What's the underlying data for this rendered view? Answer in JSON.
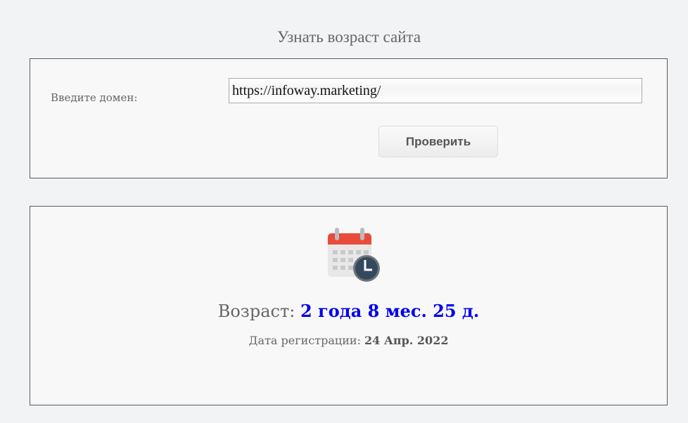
{
  "header": {
    "title": "Узнать возраст сайта"
  },
  "form": {
    "domain_label": "Введите домен:",
    "domain_value": "https://infoway.marketing/",
    "submit_label": "Проверить"
  },
  "result": {
    "age_label": "Возраст:",
    "age_value": "2 года 8 мес. 25 д.",
    "reg_label": "Дата регистрации:",
    "reg_value": "24 Апр. 2022",
    "icon": "calendar-clock-icon",
    "accent_color": "#0000ee"
  }
}
